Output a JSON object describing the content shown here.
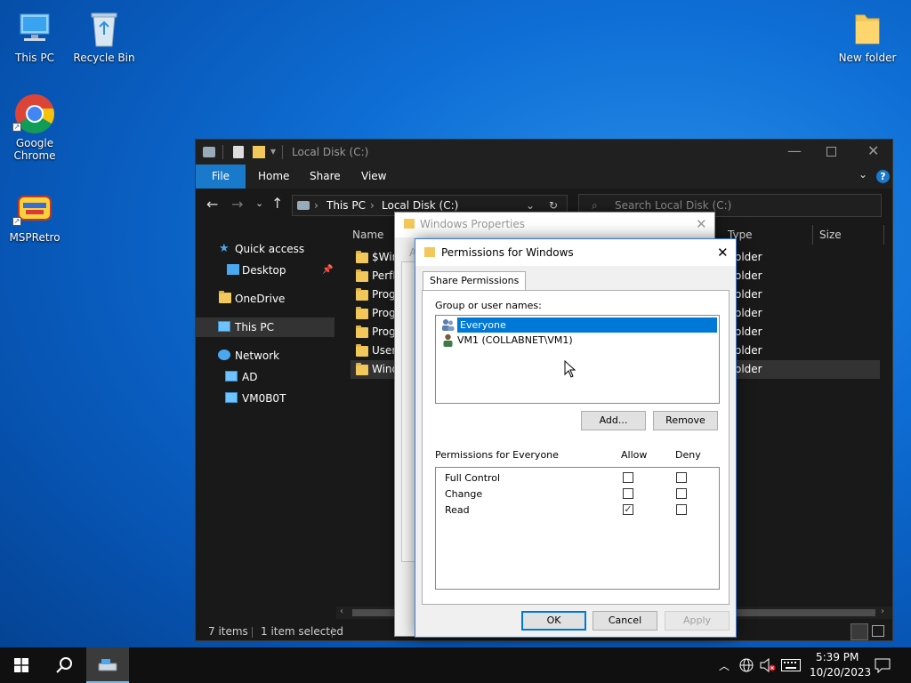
{
  "desktop": {
    "icons": [
      {
        "label": "This PC"
      },
      {
        "label": "Recycle Bin"
      },
      {
        "label": "Google\nChrome",
        "line1": "Google",
        "line2": "Chrome"
      },
      {
        "label": "MSPRetro"
      },
      {
        "label": "New folder"
      }
    ]
  },
  "explorer": {
    "title": "Local Disk (C:)",
    "ribbon_tabs": [
      "File",
      "Home",
      "Share",
      "View"
    ],
    "breadcrumb": [
      "This PC",
      "Local Disk (C:)"
    ],
    "search_placeholder": "Search Local Disk (C:)",
    "nav": [
      "Quick access",
      "Desktop",
      "OneDrive",
      "This PC",
      "Network",
      "AD",
      "VM0B0T"
    ],
    "columns": {
      "name": "Name",
      "type": "Type",
      "size": "Size"
    },
    "files": [
      {
        "name": "$Win",
        "type": "older"
      },
      {
        "name": "PerfL",
        "type": "older"
      },
      {
        "name": "Prog",
        "type": "older"
      },
      {
        "name": "Prog",
        "type": "older"
      },
      {
        "name": "Prog",
        "type": "older"
      },
      {
        "name": "Users",
        "type": "older"
      },
      {
        "name": "Wind",
        "type": "older"
      }
    ],
    "status": {
      "items": "7 items",
      "selected": "1 item selected"
    }
  },
  "properties": {
    "title": "Windows Properties",
    "tab_letter": "A"
  },
  "permissions": {
    "title": "Permissions for Windows",
    "tab": "Share Permissions",
    "group_label": "Group or user names:",
    "users": [
      "Everyone",
      "VM1 (COLLABNET\\VM1)"
    ],
    "add_label": "Add...",
    "remove_label": "Remove",
    "perm_label": "Permissions for Everyone",
    "allow_label": "Allow",
    "deny_label": "Deny",
    "perms": [
      {
        "name": "Full Control",
        "allow": false,
        "deny": false
      },
      {
        "name": "Change",
        "allow": false,
        "deny": false
      },
      {
        "name": "Read",
        "allow": true,
        "deny": false
      }
    ],
    "ok_label": "OK",
    "cancel_label": "Cancel",
    "apply_label": "Apply"
  },
  "taskbar": {
    "time": "5:39 PM",
    "date": "10/20/2023"
  },
  "colors": {
    "accent": "#0078d7",
    "folder": "#f3c85a",
    "explorer_bg": "#191919"
  }
}
